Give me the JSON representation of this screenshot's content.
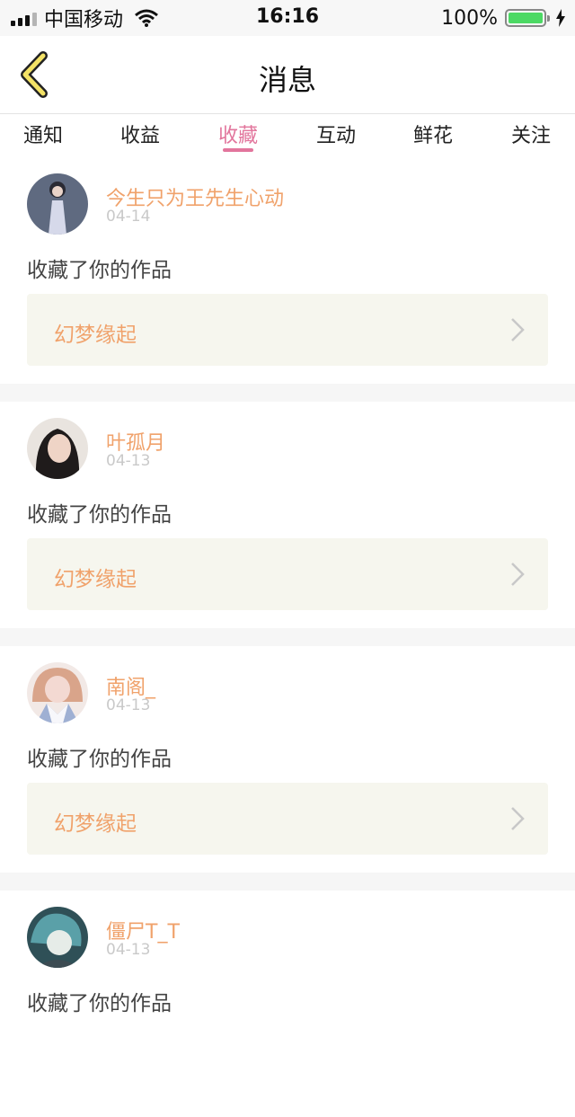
{
  "status_bar": {
    "carrier": "中国移动",
    "time": "16:16",
    "battery": "100%",
    "battery_level": 1.0
  },
  "header": {
    "title": "消息",
    "back_icon": "back-chevron-icon"
  },
  "tabs": [
    {
      "label": "通知",
      "active": false
    },
    {
      "label": "收益",
      "active": false
    },
    {
      "label": "收藏",
      "active": true
    },
    {
      "label": "互动",
      "active": false
    },
    {
      "label": "鲜花",
      "active": false
    },
    {
      "label": "关注",
      "active": false
    }
  ],
  "colors": {
    "accent_pink": "#e2759c",
    "name_orange": "#f0a26b",
    "card_bg": "#f6f6ee",
    "separator": "#f6f6f6"
  },
  "messages": [
    {
      "username": "今生只为王先生心动",
      "date": "04-14",
      "action": "收藏了你的作品",
      "work": "幻梦缘起"
    },
    {
      "username": "叶孤月",
      "date": "04-13",
      "action": "收藏了你的作品",
      "work": "幻梦缘起"
    },
    {
      "username": "南阁_",
      "date": "04-13",
      "action": "收藏了你的作品",
      "work": "幻梦缘起"
    },
    {
      "username": "僵尸T_T",
      "date": "04-13",
      "action": "收藏了你的作品",
      "work": ""
    }
  ]
}
